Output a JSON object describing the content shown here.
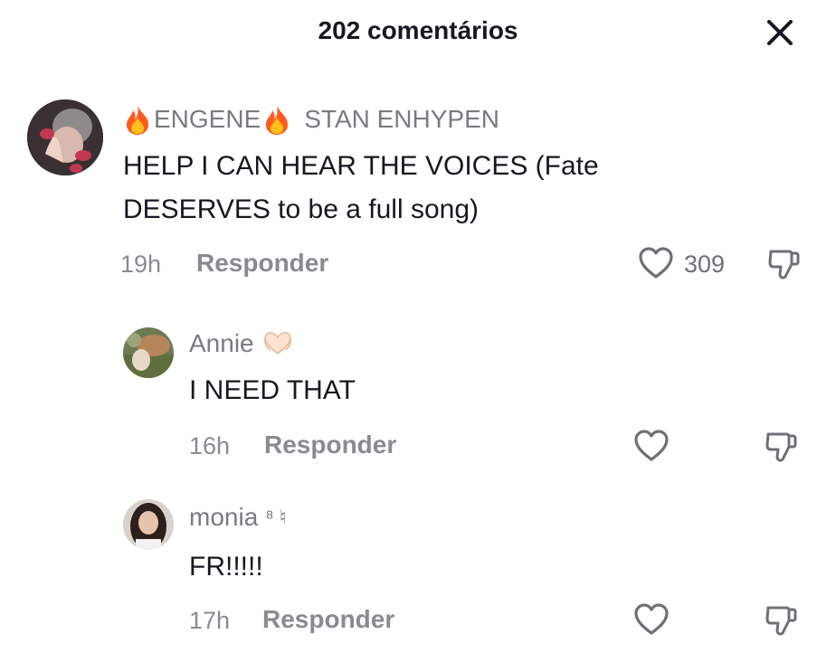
{
  "header": {
    "title": "202 comentários"
  },
  "comments": [
    {
      "author_part1": "ENGENE",
      "author_part2": "STAN ENHYPEN",
      "text": "HELP I CAN HEAR THE VOICES (Fate DESERVES to be a full song)",
      "time": "19h",
      "reply_label": "Responder",
      "likes": "309"
    },
    {
      "author": "Annie",
      "author_badge": "heart-hands",
      "text": "I NEED THAT",
      "time": "16h",
      "reply_label": "Responder"
    },
    {
      "author": "monia",
      "author_suffix": "⁸ ♮",
      "text": "FR!!!!!",
      "time": "17h",
      "reply_label": "Responder"
    }
  ],
  "colors": {
    "text": "#161823",
    "muted": "#8a8b91",
    "flame": "#ff6a00"
  }
}
